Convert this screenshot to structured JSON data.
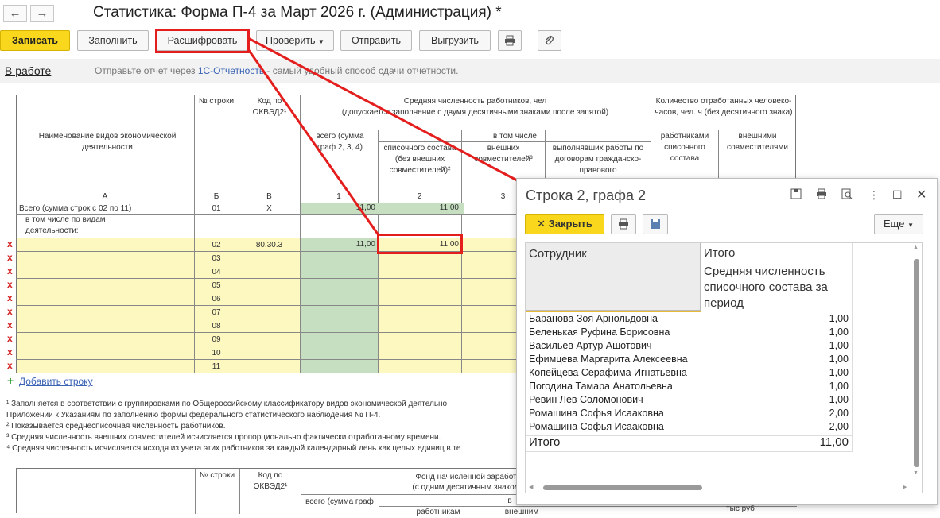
{
  "window": {
    "title": "Статистика: Форма П-4 за Март 2026 г. (Администрация) *",
    "nav_back": "←",
    "nav_forward": "→"
  },
  "toolbar": {
    "save": "Записать",
    "fill": "Заполнить",
    "decode": "Расшифровать",
    "check": "Проверить",
    "send": "Отправить",
    "export": "Выгрузить",
    "print_icon": "printer-icon",
    "attach_icon": "paperclip-icon"
  },
  "infobar": {
    "status": "В работе",
    "hint_prefix": "Отправьте отчет через ",
    "hint_link": "1С-Отчетность",
    "hint_suffix": " - самый удобный способ сдачи отчетности."
  },
  "table": {
    "h_name": "Наименование видов экономической деятельности",
    "h_row": "№ строки",
    "h_code": "Код по ОКВЭД2¹",
    "h_avg": "Средняя численность работников, чел",
    "h_avg_sub": "(допускается заполнение с двумя десятичными знаками после запятой)",
    "h_total": "всего (сумма граф 2, 3, 4)",
    "h_including": "в том числе",
    "h_list": "списочного состава (без внешних совместителей)²",
    "h_ext": "внешних совместителей³",
    "h_contract": "выполнявших работы по договорам гражданско-правового",
    "h_hours": "Количество отработанных человеко-часов, чел. ч (без десятичного знака)",
    "h_hours_emp": "работниками списочного состава",
    "h_hours_ext": "внешними совместителями",
    "col_letters": [
      "А",
      "Б",
      "В",
      "1",
      "2",
      "3"
    ],
    "total_label": "Всего (сумма строк с 02 по 11)",
    "total_row": "01",
    "total_code": "X",
    "total_v1": "11,00",
    "total_v2": "11,00",
    "by_activity": "в том числе по видам деятельности:",
    "rows": [
      {
        "n": "02",
        "code": "80.30.3",
        "v1": "11,00",
        "v2": "11,00"
      },
      {
        "n": "03"
      },
      {
        "n": "04"
      },
      {
        "n": "05"
      },
      {
        "n": "06"
      },
      {
        "n": "07"
      },
      {
        "n": "08"
      },
      {
        "n": "09"
      },
      {
        "n": "10"
      },
      {
        "n": "11"
      }
    ],
    "row_mark": "x",
    "add_row": "Добавить строку",
    "add_mark": "+"
  },
  "footnotes": [
    "¹ Заполняется в соответствии с группировками по Общероссийскому классификатору видов экономической деятельно",
    "Приложении к Указаниям по заполнению формы федерального статистического наблюдения № П-4.",
    "² Показывается среднесписочная численность работников.",
    "³ Средняя численность внешних совместителей исчисляется пропорционально фактически отработанному времени.",
    "⁴ Средняя численность исчисляется исходя из учета этих работников за каждый календарный день как целых единиц в те"
  ],
  "table2": {
    "h_row": "№ строки",
    "h_code": "Код по ОКВЭД2¹",
    "h_fund": "Фонд начисленной заработ",
    "h_fund_sub": "(с одним десятичным знаком",
    "h_total": "всего (сумма граф",
    "h_in": "в",
    "h_list": "работникам",
    "h_ext": "внешним",
    "h_units": "тыс руб"
  },
  "popup": {
    "title": "Строка 2, графа 2",
    "close": "Закрыть",
    "more": "Еще",
    "col_employee": "Сотрудник",
    "col_total": "Итого",
    "col_total_sub": "Средняя численность списочного состава за период",
    "employees": [
      {
        "name": "Баранова Зоя Арнольдовна",
        "value": "1,00"
      },
      {
        "name": "Беленькая Руфина Борисовна",
        "value": "1,00"
      },
      {
        "name": "Васильев Артур Ашотович",
        "value": "1,00"
      },
      {
        "name": "Ефимцева Маргарита Алексеевна",
        "value": "1,00"
      },
      {
        "name": "Копейцева Серафима Игнатьевна",
        "value": "1,00"
      },
      {
        "name": "Погодина Тамара Анатольевна",
        "value": "1,00"
      },
      {
        "name": "Ревин Лев Соломонович",
        "value": "1,00"
      },
      {
        "name": "Ромашина Софья Исааковна",
        "value": "2,00"
      },
      {
        "name": "Ромашина Софья Исааковна",
        "value": "2,00"
      }
    ],
    "total_label": "Итого",
    "total_value": "11,00"
  },
  "colors": {
    "accent_yellow": "#f9d71c",
    "highlight_red": "#e41d1d",
    "cell_green": "#c5dfc0",
    "cell_yellow": "#fdf8c0",
    "link_blue": "#3a63b5"
  }
}
